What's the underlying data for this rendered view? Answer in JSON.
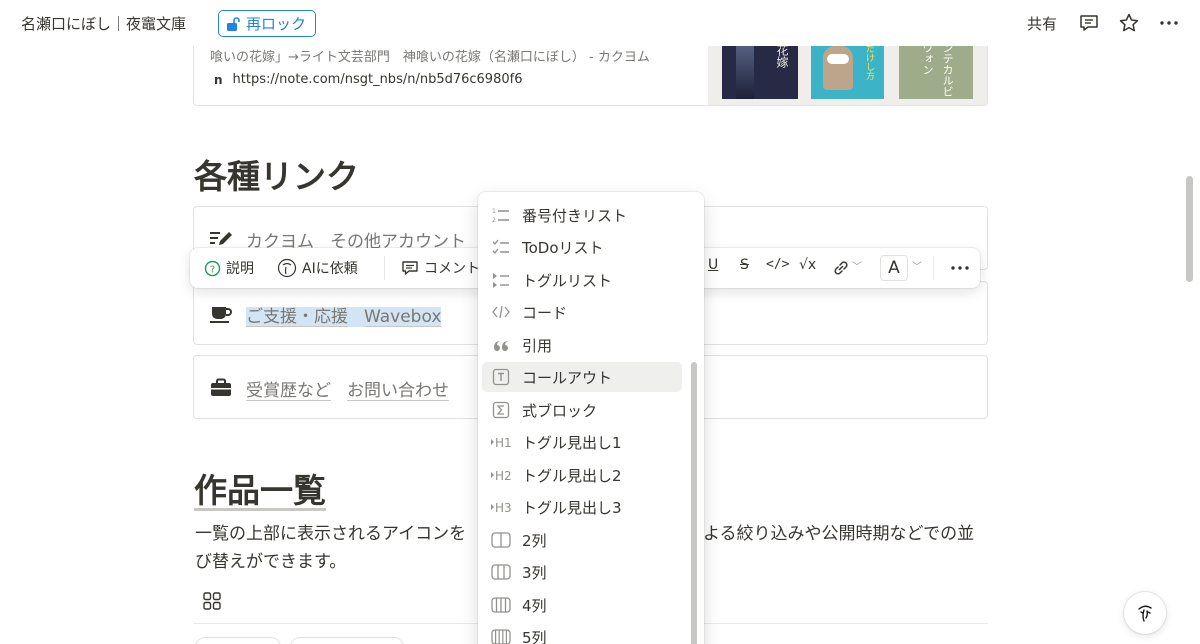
{
  "topbar": {
    "breadcrumb": "名瀬口にぼし｜夜竈文庫",
    "relock_label": "再ロック",
    "share_label": "共有"
  },
  "bookmark": {
    "description": "喰いの花嫁」→ライト文芸部門　神喰いの花嫁（名瀬口にぼし） - カクヨム",
    "favicon": "n",
    "url": "https://note.com/nsgt_nbs/n/nb5d76c6980f6",
    "cover_texts": [
      "花嫁",
      "だけし方",
      "ンテカルビ　ヴォン"
    ]
  },
  "sections": {
    "links_title": "各種リンク",
    "works_title": "作品一覧"
  },
  "links": [
    {
      "icon": "pencil-lines-icon",
      "items": [
        "カクヨム",
        "その他アカウント"
      ]
    },
    {
      "icon": "coffee-cup-icon",
      "items": [
        "ご支援・応援",
        "Wavebox"
      ]
    },
    {
      "icon": "briefcase-icon",
      "items": [
        "受賞歴など",
        "お問い合わせ"
      ]
    }
  ],
  "toolbar": {
    "explain_label": "説明",
    "ai_label": "AIに依頼",
    "comment_label": "コメント",
    "color_label": "A"
  },
  "body": {
    "para_line1_left": "一覧の上部に表示されるアイコンを",
    "para_line1_right": "よる絞り込みや公開時期などでの並",
    "para_line2": "び替えができます。"
  },
  "menu": {
    "items": [
      {
        "label": "番号付きリスト",
        "icon": "numbered-list-icon"
      },
      {
        "label": "ToDoリスト",
        "icon": "todo-list-icon"
      },
      {
        "label": "トグルリスト",
        "icon": "toggle-list-icon"
      },
      {
        "label": "コード",
        "icon": "code-icon"
      },
      {
        "label": "引用",
        "icon": "quote-icon"
      },
      {
        "label": "コールアウト",
        "icon": "callout-icon"
      },
      {
        "label": "式ブロック",
        "icon": "equation-icon"
      },
      {
        "label": "トグル見出し1",
        "icon": "toggle-heading-1-icon"
      },
      {
        "label": "トグル見出し2",
        "icon": "toggle-heading-2-icon"
      },
      {
        "label": "トグル見出し3",
        "icon": "toggle-heading-3-icon"
      },
      {
        "label": "2列",
        "icon": "columns-2-icon"
      },
      {
        "label": "3列",
        "icon": "columns-3-icon"
      },
      {
        "label": "4列",
        "icon": "columns-4-icon"
      },
      {
        "label": "5列",
        "icon": "columns-5-icon"
      }
    ],
    "highlighted_index": 5,
    "icon_glyphs": {
      "h1": "H1",
      "h2": "H2",
      "h3": "H3"
    }
  },
  "colors": {
    "accent": "#2383e2",
    "text": "#37352f",
    "muted": "#787774",
    "selection": "#d3e5f3"
  }
}
